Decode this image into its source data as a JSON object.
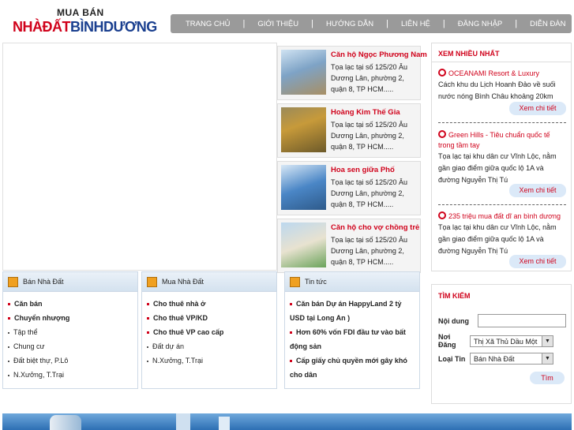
{
  "logo": {
    "top": "MUA BÁN",
    "part1": "NHÀĐẤT",
    "part2": "BÌNHDƯƠNG"
  },
  "nav": [
    "TRANG CHỦ",
    "GIỚI THIỆU",
    "HƯỚNG DẪN",
    "LIÊN HỆ",
    "ĐĂNG NHẬP",
    "DIỄN ĐÀN"
  ],
  "nav_sep": "|",
  "listings": [
    {
      "title": "Căn hộ Ngọc Phương Nam",
      "desc": "Tọa lạc tại số 125/20 Âu Dương Lân, phường 2, quận 8, TP HCM....."
    },
    {
      "title": "Hoàng Kim Thế Gia",
      "desc": "Tọa lạc tại số 125/20 Âu Dương Lân, phường 2, quận 8, TP HCM....."
    },
    {
      "title": "Hoa sen giữa Phố",
      "desc": "Tọa lạc tại số 125/20 Âu Dương Lân, phường 2, quận 8, TP HCM....."
    },
    {
      "title": "Căn hộ cho vợ chồng trẻ",
      "desc": "Tọa lạc tại số 125/20 Âu Dương Lân, phường 2, quận 8, TP HCM....."
    }
  ],
  "categories": {
    "ban": {
      "title": "Bán Nhà Đất",
      "items": [
        "Căn bán",
        "Chuyển nhượng",
        "Tập thể",
        "Chung cư",
        "Đất biệt thự, P.Lô",
        "N.Xưởng, T.Trại"
      ]
    },
    "mua": {
      "title": "Mua Nhà Đất",
      "items": [
        "Cho thuê nhà ở",
        "Cho thuê VP/KD",
        "Cho thuê VP cao cấp",
        "Đất dự án",
        "N.Xưởng, T.Trại"
      ]
    },
    "news": {
      "title": "Tin tức",
      "items": [
        "Căn bán Dự án HappyLand 2 tỷ USD tại Long An )",
        "Hơn 60% vốn FDI đầu tư vào bất động sản",
        "Cấp giấy chủ quyền mới gây khó cho dân"
      ]
    }
  },
  "most_viewed": {
    "title": "XEM NHIỀU NHẤT",
    "entries": [
      {
        "title": "OCEANAMI Resort & Luxury",
        "desc": "Cách khu du Lịch Hoanh Đảo về suối nước nóng Bình Châu khoảng 20km",
        "button": "Xem chi tiết"
      },
      {
        "title": "Green Hills - Tiêu chuẩn quốc tế trong tầm tay",
        "desc": "Tọa lạc tại khu dân cư Vĩnh Lộc, nằm gần giao điểm giữa quốc lộ 1A và đường Nguyễn Thị Tú",
        "button": "Xem chi tiết"
      },
      {
        "title": "235 triệu mua đất dĩ an bình dương",
        "desc": "Tọa lạc tại khu dân cư Vĩnh Lộc, nằm gần giao điểm giữa quốc lộ 1A và đường Nguyễn Thị Tú",
        "button": "Xem chi tiết"
      }
    ]
  },
  "search": {
    "title": "TÌM KIẾM",
    "content_label": "Nội dung",
    "content_value": "",
    "location_label": "Nơi Đăng",
    "location_value": "Thị Xã Thủ Dầu Một",
    "type_label": "Loại Tin",
    "type_value": "Bán Nhà Đất",
    "button": "Tìm"
  },
  "colors": {
    "accent": "#d0021b",
    "brand_blue": "#1a3f8f",
    "nav_bg": "#9a9a9a"
  }
}
